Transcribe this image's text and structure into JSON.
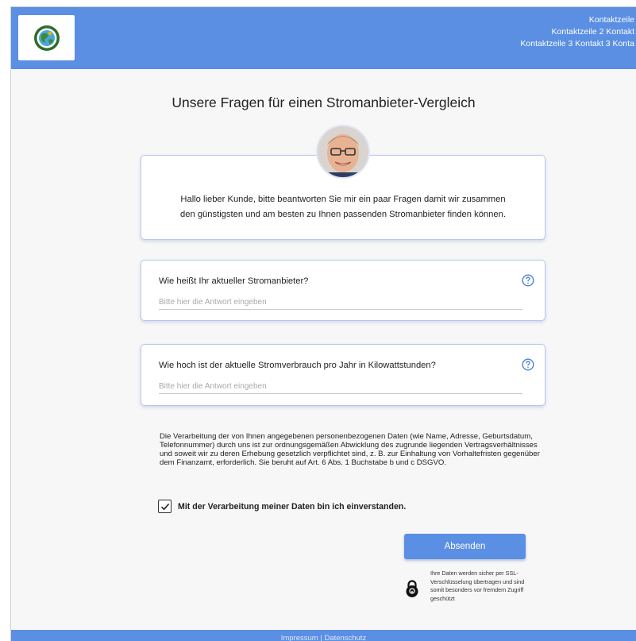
{
  "header": {
    "logo_alt": "logo",
    "contact_lines": [
      "Kontaktzeile",
      "Kontaktzeile 2 Kontakt",
      "Kontaktzeile 3 Kontakt 3 Konta"
    ],
    "color": "#5a8fe3"
  },
  "page": {
    "title": "Unsere Fragen für einen Stromanbieter-Vergleich"
  },
  "intro": {
    "line1": "Hallo lieber Kunde, bitte beantworten Sie mir ein paar Fragen damit wir zusammen",
    "line2": "den günstigsten und am besten zu Ihnen passenden Stromanbieter finden können."
  },
  "questions": [
    {
      "label": "Wie heißt Ihr aktueller Stromanbieter?",
      "placeholder": "Bitte hier die Antwort eingeben",
      "help_icon": "question-circle-icon"
    },
    {
      "label": "Wie hoch ist der aktuelle Stromverbrauch pro Jahr in Kilowattstunden?",
      "placeholder": "Bitte hier die Antwort eingeben",
      "help_icon": "question-circle-icon"
    }
  ],
  "privacy_text": "Die Verarbeitung der von Ihnen angegebenen personenbezogenen Daten (wie Name, Adresse, Geburtsdatum, Telefonnummer) durch uns ist zur ordnungsgemäßen Abwicklung des zugrunde liegenden Vertragsverhältnisses und soweit wir zu deren Erhebung gesetzlich verpflichtet sind, z. B. zur Einhaltung von Vorhaltefristen gegenüber dem Finanzamt, erforderlich. Sie beruht auf Art. 6 Abs. 1 Buchstabe b und c DSGVO.",
  "consent": {
    "label": "Mit der Verarbeitung meiner Daten bin ich einverstanden.",
    "checked": true
  },
  "submit": {
    "label": "Absenden"
  },
  "ssl": {
    "icon": "lock-icon",
    "text": "Ihre Daten werden sicher per SSL-Verschlüsselung übertragen und sind somit besonders vor fremdem Zugriff geschützt"
  },
  "footer": {
    "text": "Impressum | Datenschutz"
  }
}
